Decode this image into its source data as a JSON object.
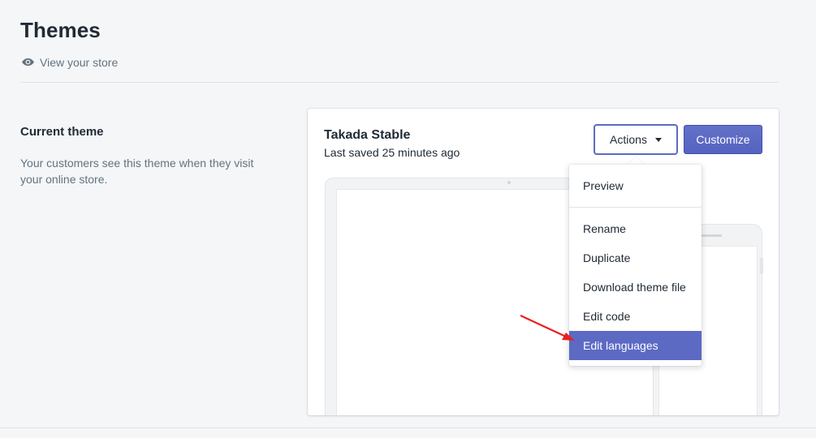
{
  "header": {
    "title": "Themes",
    "view_store_label": "View your store",
    "view_store_icon": "eye-icon"
  },
  "current_theme_section": {
    "title": "Current theme",
    "description": "Your customers see this theme when they visit your online store."
  },
  "theme_card": {
    "name": "Takada Stable",
    "last_saved": "Last saved 25 minutes ago",
    "actions_label": "Actions",
    "customize_label": "Customize"
  },
  "actions_menu": {
    "items": [
      {
        "label": "Preview"
      },
      {
        "label": "Rename"
      },
      {
        "label": "Duplicate"
      },
      {
        "label": "Download theme file"
      },
      {
        "label": "Edit code"
      },
      {
        "label": "Edit languages",
        "highlighted": true
      }
    ]
  },
  "colors": {
    "accent": "#5c6ac4",
    "background": "#f4f6f8",
    "annotation_arrow": "#e8201f"
  }
}
